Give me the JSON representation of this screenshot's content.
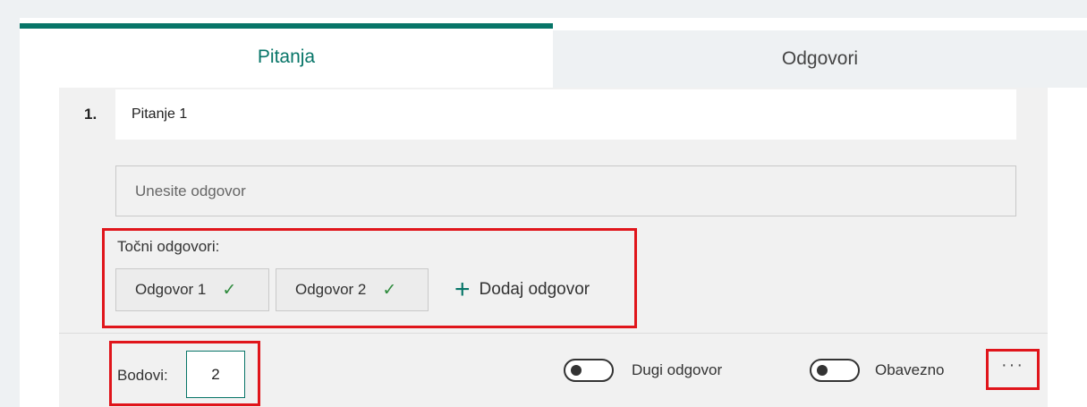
{
  "tabs": {
    "questions_label": "Pitanja",
    "responses_label": "Odgovori"
  },
  "question": {
    "number": "1.",
    "title": "Pitanje 1",
    "answer_placeholder": "Unesite odgovor"
  },
  "correct_answers": {
    "label": "Točni odgovori:",
    "items": [
      {
        "label": "Odgovor 1",
        "check": "✓"
      },
      {
        "label": "Odgovor 2",
        "check": "✓"
      }
    ],
    "add_icon": "+",
    "add_label": "Dodaj odgovor"
  },
  "footer": {
    "points_label": "Bodovi:",
    "points_value": "2",
    "long_answer_label": "Dugi odgovor",
    "required_label": "Obavezno",
    "more_icon": "···"
  },
  "colors": {
    "accent": "#077568",
    "highlight": "#e0151b"
  }
}
